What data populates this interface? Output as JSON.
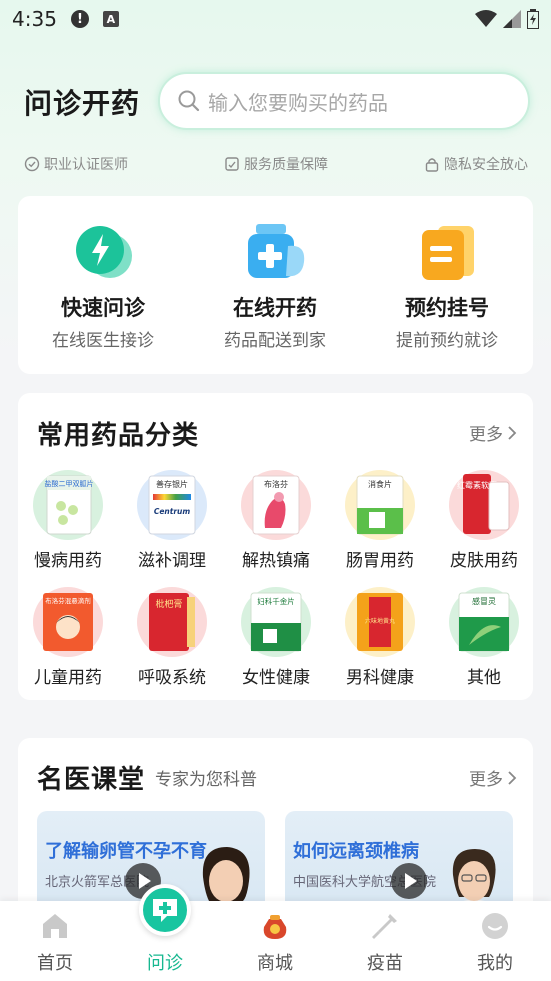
{
  "status_bar": {
    "time": "4:35",
    "alert_glyph": "!",
    "a_glyph": "A"
  },
  "header": {
    "title": "问诊开药"
  },
  "search": {
    "placeholder": "输入您要购买的药品"
  },
  "badges": [
    "职业认证医师",
    "服务质量保障",
    "隐私安全放心"
  ],
  "services": [
    {
      "title": "快速问诊",
      "subtitle": "在线医生接诊",
      "icon": "chat-bolt-icon"
    },
    {
      "title": "在线开药",
      "subtitle": "药品配送到家",
      "icon": "medicine-bottle-icon"
    },
    {
      "title": "预约挂号",
      "subtitle": "提前预约就诊",
      "icon": "appointment-icon"
    }
  ],
  "categories": {
    "title": "常用药品分类",
    "more": "更多",
    "items": [
      {
        "label": "慢病用药",
        "box_text": "盐酸二甲双胍片"
      },
      {
        "label": "滋补调理",
        "box_text": "善存银片",
        "box_text2": "Centrum"
      },
      {
        "label": "解热镇痛",
        "box_text": "布洛芬"
      },
      {
        "label": "肠胃用药",
        "box_text": "消食片"
      },
      {
        "label": "皮肤用药",
        "box_text": "红霉素软膏"
      },
      {
        "label": "儿童用药",
        "box_text": "布洛芬混悬滴剂"
      },
      {
        "label": "呼吸系统",
        "box_text": "枇杷膏"
      },
      {
        "label": "女性健康",
        "box_text": "妇科千金片"
      },
      {
        "label": "男科健康",
        "box_text": "六味地黄丸"
      },
      {
        "label": "其他",
        "box_text": "感冒灵"
      }
    ]
  },
  "doctor_class": {
    "title": "名医课堂",
    "subtitle": "专家为您科普",
    "more": "更多",
    "videos": [
      {
        "title": "了解输卵管不孕不育",
        "hospital": "北京火箭军总医院"
      },
      {
        "title": "如何远离颈椎病",
        "hospital": "中国医科大学航空总医院"
      }
    ]
  },
  "tabbar": {
    "items": [
      {
        "label": "首页",
        "icon": "home-icon"
      },
      {
        "label": "问诊",
        "icon": "consult-icon",
        "active": true
      },
      {
        "label": "商城",
        "icon": "mall-bag-icon"
      },
      {
        "label": "疫苗",
        "icon": "vaccine-icon"
      },
      {
        "label": "我的",
        "icon": "profile-icon"
      }
    ]
  },
  "colors": {
    "accent": "#18c5a0",
    "active_tab": "#17b890",
    "video_title": "#2f6fd8"
  }
}
